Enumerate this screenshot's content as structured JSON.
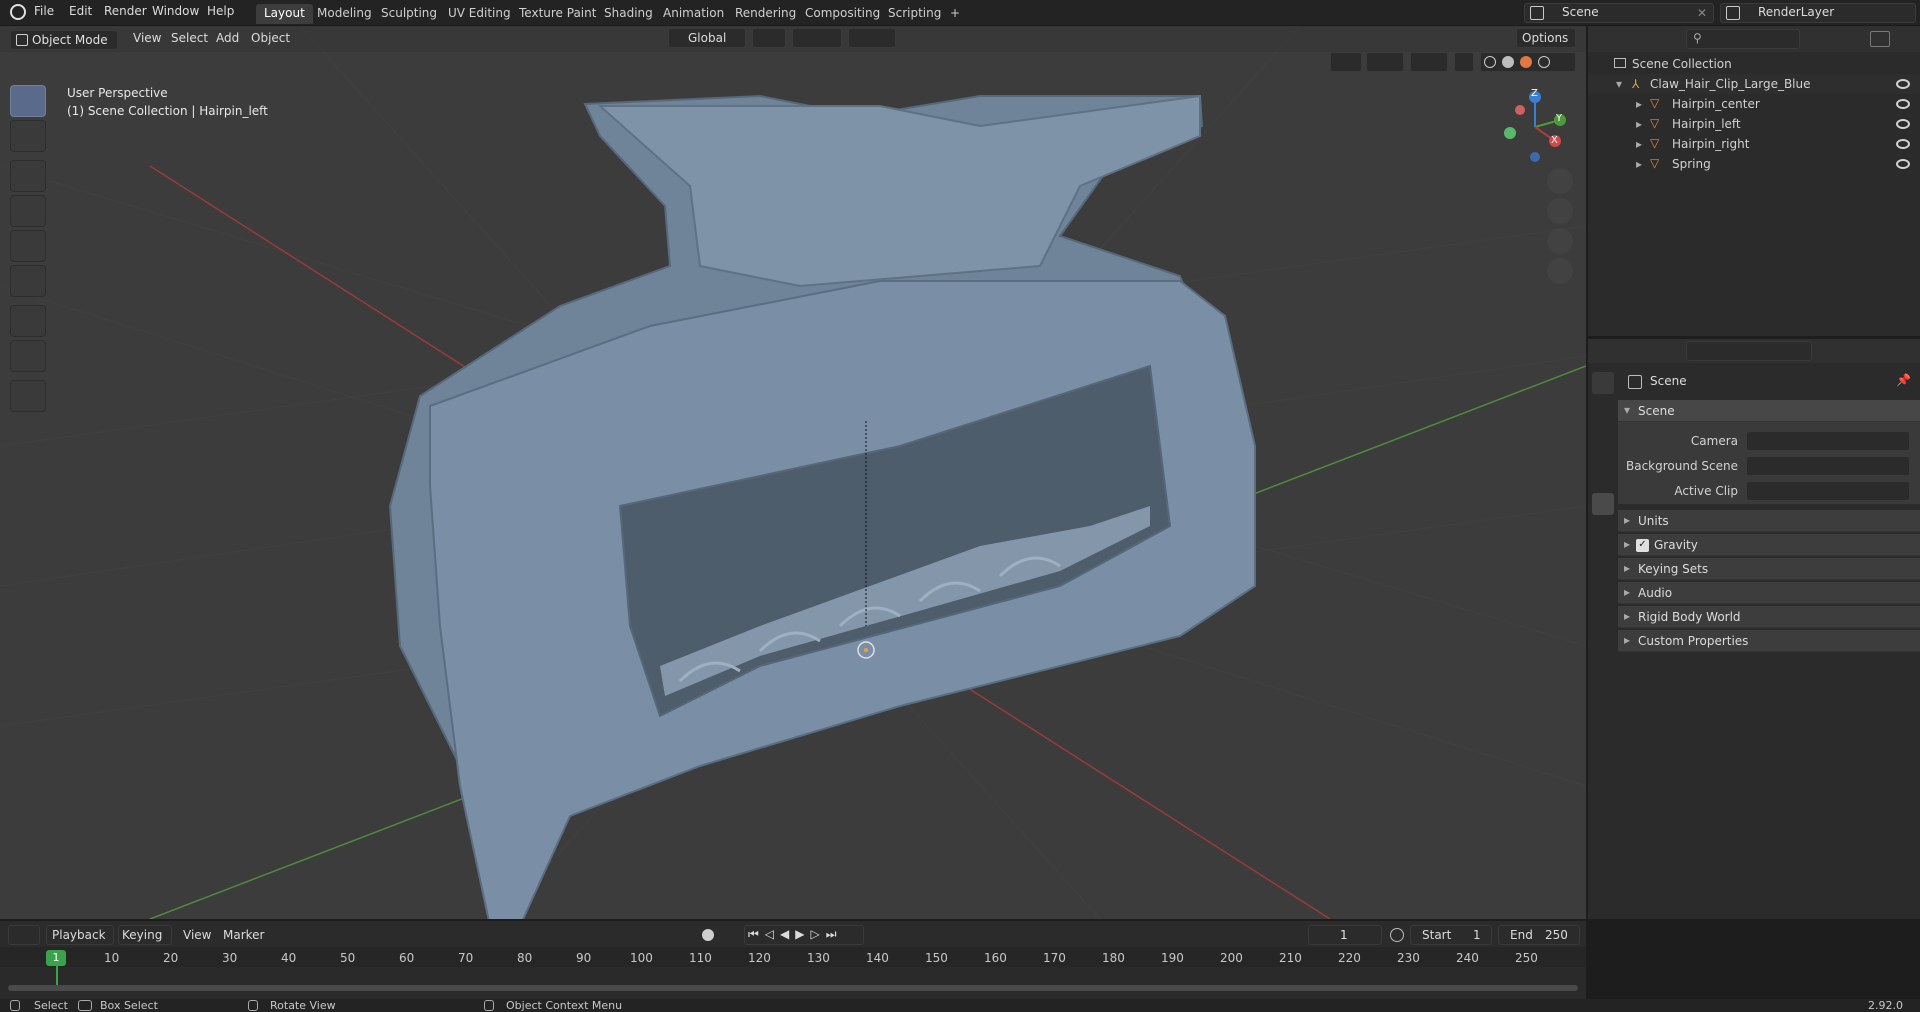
{
  "top_menu": {
    "items": [
      "File",
      "Edit",
      "Render",
      "Window",
      "Help"
    ],
    "workspace_tabs": [
      "Layout",
      "Modeling",
      "Sculpting",
      "UV Editing",
      "Texture Paint",
      "Shading",
      "Animation",
      "Rendering",
      "Compositing",
      "Scripting"
    ],
    "active_tab": "Layout",
    "add_tab": "+",
    "scene_name": "Scene",
    "view_layer": "RenderLayer"
  },
  "viewport_header": {
    "mode": "Object Mode",
    "menus": [
      "View",
      "Select",
      "Add",
      "Object"
    ],
    "orientation": "Global",
    "options": "Options"
  },
  "viewport": {
    "perspective_label": "User Perspective",
    "collection_label": "(1) Scene Collection | Hairpin_left",
    "background": "#3c3c3c",
    "axes": {
      "x_color": "#b23a3a",
      "y_color": "#4c9a3a",
      "z_color": "#3b7fd0"
    },
    "gizmo_labels": {
      "x": "X",
      "y": "Y",
      "z": "Z"
    }
  },
  "toolbar": {
    "tools": [
      "select-box-icon",
      "cursor-icon",
      "move-icon",
      "rotate-icon",
      "scale-icon",
      "transform-icon",
      "annotate-icon",
      "measure-icon",
      "add-cube-icon"
    ]
  },
  "outliner": {
    "root": "Scene Collection",
    "collection": "Claw_Hair_Clip_Large_Blue",
    "objects": [
      "Hairpin_center",
      "Hairpin_left",
      "Hairpin_right",
      "Spring"
    ]
  },
  "properties": {
    "context_title": "Scene",
    "section": "Scene",
    "fields": [
      {
        "label": "Camera",
        "value": ""
      },
      {
        "label": "Background Scene",
        "value": ""
      },
      {
        "label": "Active Clip",
        "value": ""
      }
    ],
    "panels": [
      "Units",
      "Gravity",
      "Keying Sets",
      "Audio",
      "Rigid Body World",
      "Custom Properties"
    ],
    "gravity_checked": true
  },
  "timeline": {
    "menus": [
      "Playback",
      "Keying",
      "View",
      "Marker"
    ],
    "current_frame": "1",
    "start_label": "Start",
    "start": "1",
    "end_label": "End",
    "end": "250",
    "ruler": [
      "10",
      "20",
      "30",
      "40",
      "50",
      "60",
      "70",
      "80",
      "90",
      "100",
      "110",
      "120",
      "130",
      "140",
      "150",
      "160",
      "170",
      "180",
      "190",
      "200",
      "210",
      "220",
      "230",
      "240",
      "250"
    ],
    "playhead": "1"
  },
  "status_bar": {
    "items": [
      "Select",
      "Box Select",
      "Rotate View",
      "Object Context Menu"
    ],
    "version": "2.92.0"
  }
}
